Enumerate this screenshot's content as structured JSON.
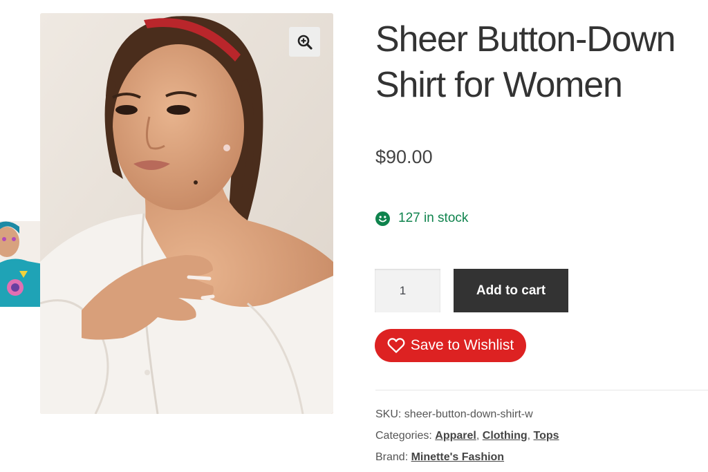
{
  "product": {
    "title": "Sheer Button-Down Shirt for Women",
    "price": "$90.00",
    "stock_text": "127 in stock",
    "quantity": "1"
  },
  "buttons": {
    "add_to_cart": "Add to cart",
    "wishlist": "Save to Wishlist"
  },
  "meta": {
    "sku_label": "SKU:",
    "sku_value": "sheer-button-down-shirt-w",
    "categories_label": "Categories:",
    "categories": [
      "Apparel",
      "Clothing",
      "Tops"
    ],
    "separator": ",",
    "brand_label": "Brand:",
    "brand": "Minette's Fashion"
  },
  "icons": {
    "zoom": "zoom-in-icon",
    "stock": "smiley-icon",
    "wishlist": "heart-icon"
  },
  "colors": {
    "stock_green": "#0f834d",
    "wishlist_red": "#dd2222",
    "cart_dark": "#333333"
  }
}
